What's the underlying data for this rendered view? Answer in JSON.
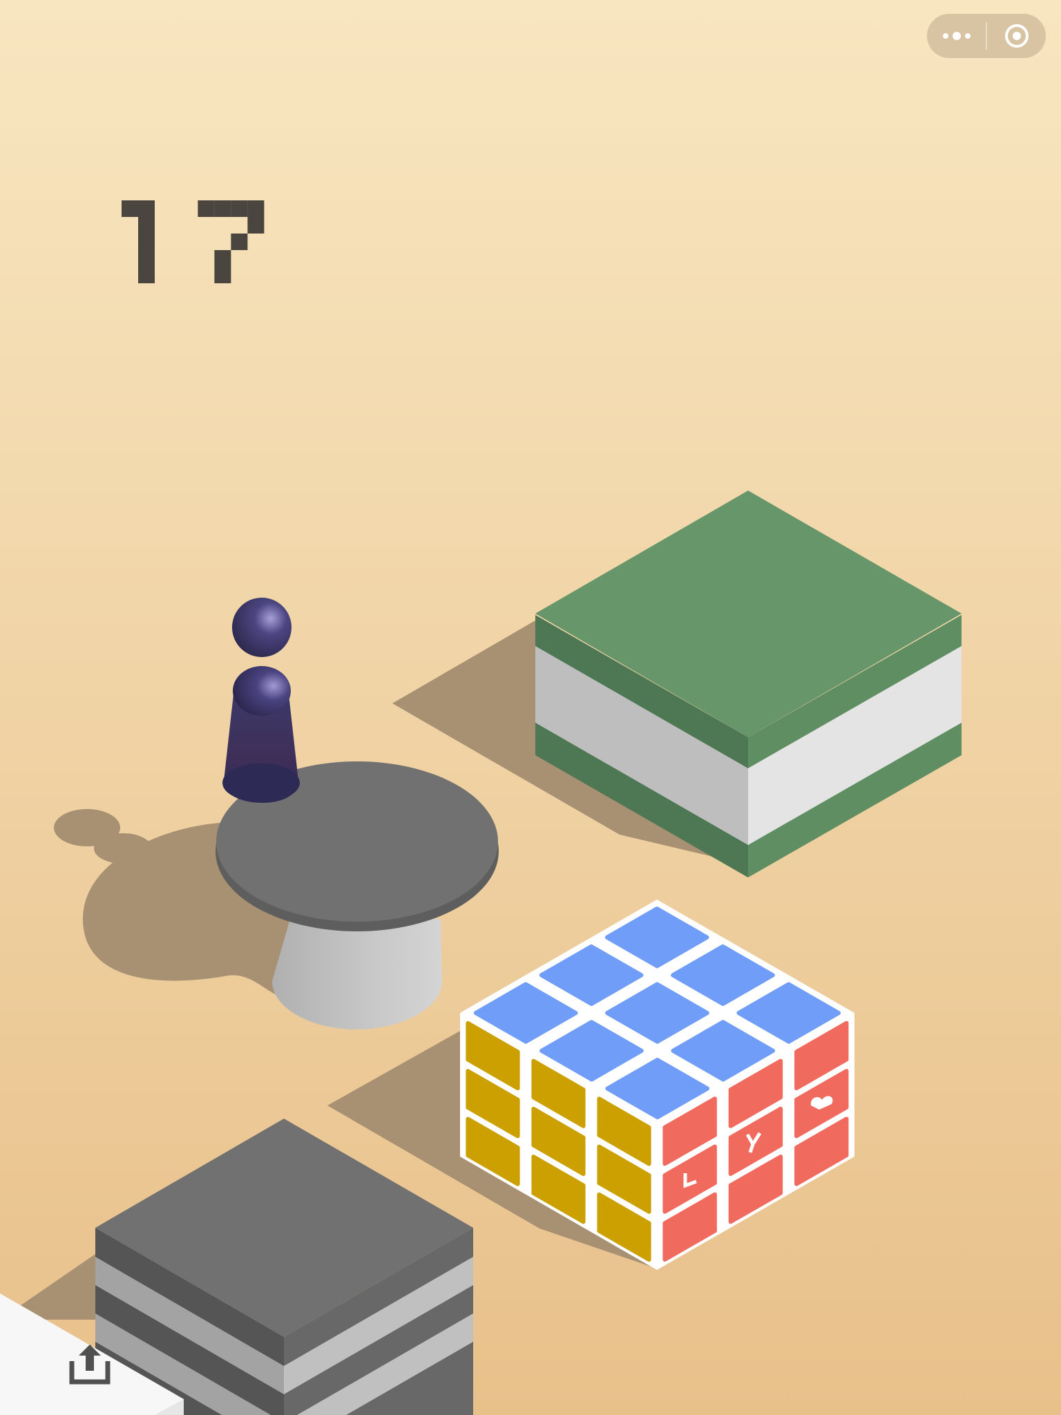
{
  "game": {
    "score": "17"
  },
  "capsule": {
    "more_icon": "more-dots-icon",
    "close_icon": "target-close-icon"
  },
  "share": {
    "icon": "share-upload-icon"
  },
  "colors": {
    "bg_top": "#F8E6C0",
    "bg_bottom": "#E8C08A",
    "score": "#4A463F",
    "shadow": "#A89072",
    "green_top": "#66966A",
    "cube_blue": "#6F9DF7",
    "cube_yellow": "#CBA000",
    "cube_red": "#F06A5E",
    "platform_gray": "#717171",
    "piece": "#3A3560"
  }
}
